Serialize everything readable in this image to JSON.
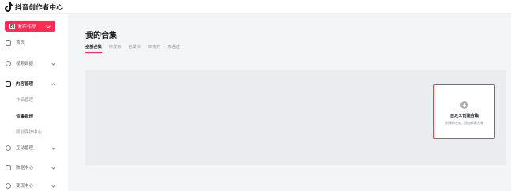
{
  "brand": {
    "name": "抖音创作者中心",
    "icon": "douyin-note-icon"
  },
  "sidebar": {
    "publish_label": "发布作品",
    "items": [
      {
        "label": "首页",
        "icon": "home-icon"
      },
      {
        "label": "视频数据",
        "icon": "chart-icon"
      },
      {
        "label": "内容管理",
        "icon": "content-icon",
        "expanded": true,
        "children": [
          {
            "label": "作品管理"
          },
          {
            "label": "合集管理",
            "active": true
          },
          {
            "label": "原创保护中心"
          }
        ]
      },
      {
        "label": "互动管理",
        "icon": "interaction-icon"
      },
      {
        "label": "数据中心",
        "icon": "data-icon"
      },
      {
        "label": "变现中心",
        "icon": "money-icon"
      }
    ]
  },
  "main": {
    "title": "我的合集",
    "tabs": [
      {
        "label": "全部合集",
        "active": true
      },
      {
        "label": "待发布"
      },
      {
        "label": "已发布"
      },
      {
        "label": "审核中"
      },
      {
        "label": "未通过"
      }
    ],
    "create_card": {
      "title": "自定义创建合集",
      "desc": "创建新合集，添加新建合集"
    }
  },
  "colors": {
    "accent": "#fe2c55",
    "highlight_border": "#f23d4b",
    "panel_bg": "#ebecef"
  }
}
